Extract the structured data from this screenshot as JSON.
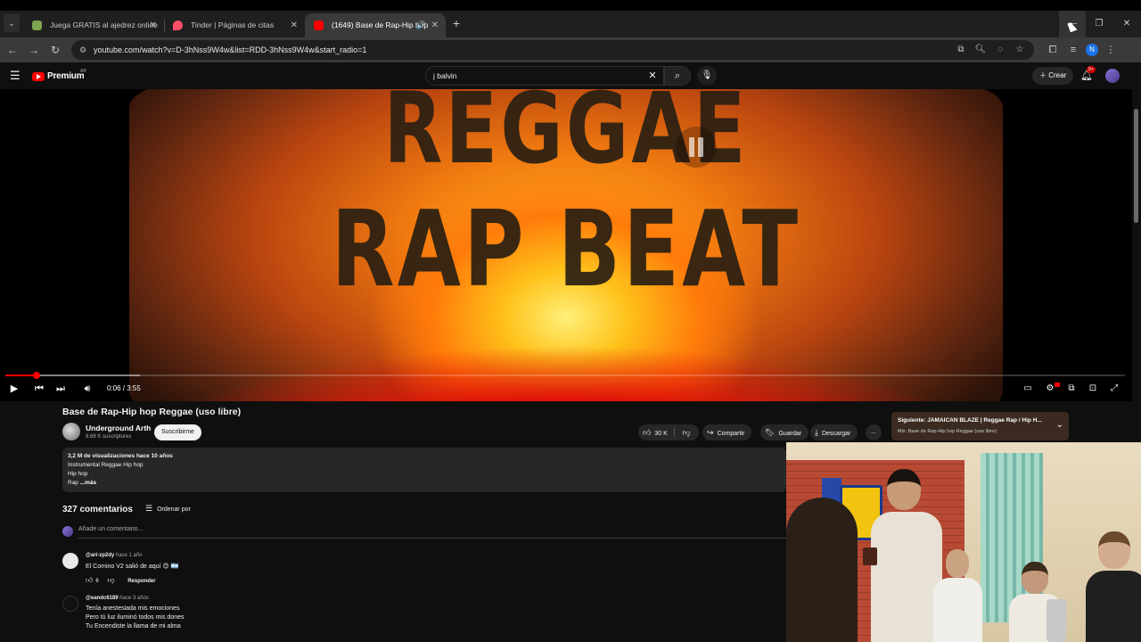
{
  "browser": {
    "tabs": [
      {
        "title": "Juega GRATIS al ajedrez online",
        "favicon_color": "#7fa650"
      },
      {
        "title": "Tinder | Páginas de citas",
        "favicon_color": "#fd5068"
      },
      {
        "title": "(1649) Base de Rap-Hip hop",
        "favicon_color": "#ff0000",
        "active": true,
        "audio": true
      }
    ],
    "url": "youtube.com/watch?v=D-3hNss9W4w&list=RDD-3hNss9W4w&start_radio=1",
    "profile_initial": "N"
  },
  "masthead": {
    "logo_text": "Premium",
    "country": "AR",
    "search_value": "j balvin",
    "create_label": "Crear",
    "notifications_badge": "9+"
  },
  "player": {
    "video_text_line1": "REGGAE",
    "video_text_line2": "RAP BEAT",
    "time": "0:06 / 3:55",
    "progress_played": 0.028,
    "progress_buffered": 0.12
  },
  "video": {
    "title": "Base de Rap-Hip hop Reggae (uso libre)",
    "channel": "Underground Arth",
    "subscribers": "9,68 K suscriptores",
    "subscribe_label": "Suscribirme",
    "likes": "30 K",
    "share_label": "Compartir",
    "save_label": "Guardar",
    "download_label": "Descargar",
    "more_label": "..."
  },
  "next_up": {
    "title": "Siguiente: JAMAICAN BLAZE | Reggae Rap / Hip H...",
    "subtitle": "Mix: Base de Rap-Hip hop Reggae (uso libre)"
  },
  "description": {
    "stats": "3,2 M de visualizaciones  hace 10 años",
    "lines": [
      "Instrumental Reggae Hip hop",
      "Hip hop"
    ],
    "last_line": "Rap",
    "more": "...más"
  },
  "comments": {
    "count": "327 comentarios",
    "sort_label": "Ordenar por",
    "add_placeholder": "Añade un comentario...",
    "items": [
      {
        "author": "@ari-zp2dy",
        "time": "hace 1 año",
        "text": "El Comino V2 salió de aquí 😊 🇦🇷",
        "likes": "6",
        "reply": "Responder"
      },
      {
        "author": "@eandc6189",
        "time": "hace 3 años",
        "lines": [
          "Tenía anestesiada mis emociones",
          "Pero tú luz iluminó todos mis dones",
          "Tu Encendiste la llama de mi alma"
        ]
      }
    ]
  }
}
